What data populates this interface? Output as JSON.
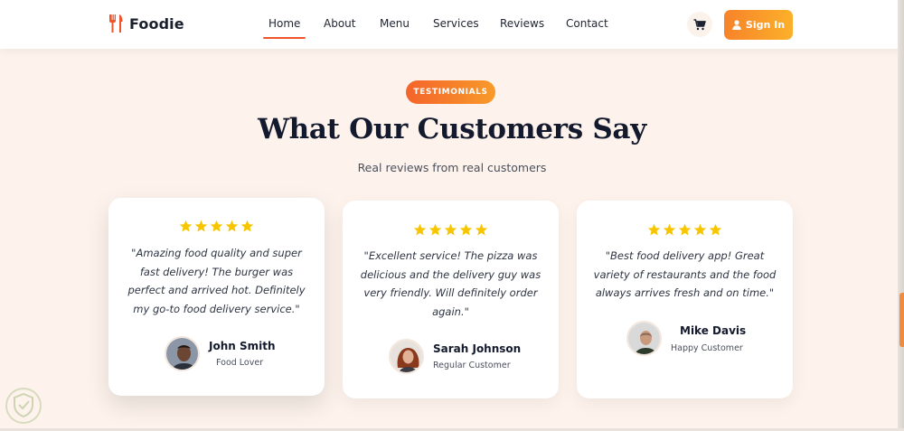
{
  "navbar": {
    "brand_name": "Foodie",
    "links": [
      {
        "label": "Home",
        "active": true
      },
      {
        "label": "About",
        "active": false
      },
      {
        "label": "Menu",
        "active": false
      },
      {
        "label": "Services",
        "active": false
      },
      {
        "label": "Reviews",
        "active": false
      },
      {
        "label": "Contact",
        "active": false
      }
    ],
    "cart_icon": "cart-icon",
    "signin_label": "Sign In",
    "signin_icon": "user-icon"
  },
  "section": {
    "badge": "TESTIMONIALS",
    "title": "What Our Customers Say",
    "subtitle": "Real reviews from real customers"
  },
  "testimonials": [
    {
      "rating": 5,
      "quote": "\"Amazing food quality and super fast delivery! The burger was perfect and arrived hot. Definitely my go-to food delivery service.\"",
      "name": "John Smith",
      "role": "Food Lover"
    },
    {
      "rating": 5,
      "quote": "\"Excellent service! The pizza was delicious and the delivery guy was very friendly. Will definitely order again.\"",
      "name": "Sarah Johnson",
      "role": "Regular Customer"
    },
    {
      "rating": 5,
      "quote": "\"Best food delivery app! Great variety of restaurants and the food always arrives fresh and on time.\"",
      "name": "Mike Davis",
      "role": "Happy Customer"
    }
  ],
  "colors": {
    "accent": "#f0542a",
    "accent_gradient_end": "#fcb02a",
    "star": "#f7c600",
    "page_bg": "#fdf3ec",
    "heading": "#141a2e"
  }
}
